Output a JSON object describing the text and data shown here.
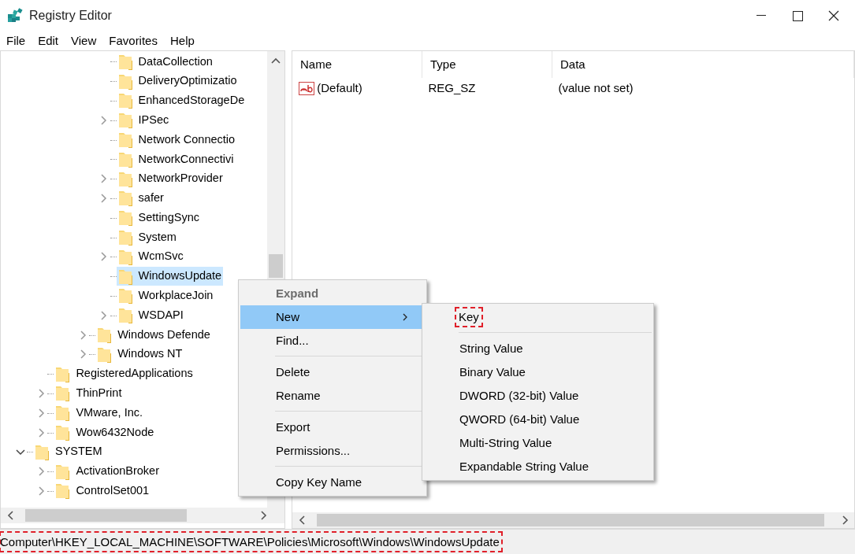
{
  "window": {
    "title": "Registry Editor"
  },
  "menu_bar": [
    "File",
    "Edit",
    "View",
    "Favorites",
    "Help"
  ],
  "tree": [
    {
      "children": [
        {
          "children": [
            {
              "children": [
                {
                  "children": [
                    {
                      "label": "DataCollection",
                      "selected": false
                    },
                    {
                      "label": "DeliveryOptimizatio",
                      "selected": false
                    },
                    {
                      "label": "EnhancedStorageDe",
                      "selected": false
                    },
                    {
                      "label": "IPSec",
                      "expanded": false,
                      "selected": false
                    },
                    {
                      "label": "Network Connectio",
                      "selected": false
                    },
                    {
                      "label": "NetworkConnectivi",
                      "selected": false
                    },
                    {
                      "label": "NetworkProvider",
                      "expanded": false,
                      "selected": false
                    },
                    {
                      "label": "safer",
                      "expanded": false,
                      "selected": false
                    },
                    {
                      "label": "SettingSync",
                      "selected": false
                    },
                    {
                      "label": "System",
                      "selected": false
                    },
                    {
                      "label": "WcmSvc",
                      "expanded": false,
                      "selected": false
                    },
                    {
                      "label": "WindowsUpdate",
                      "selected": true
                    },
                    {
                      "label": "WorkplaceJoin",
                      "selected": false
                    },
                    {
                      "label": "WSDAPI",
                      "expanded": false,
                      "selected": false
                    }
                  ]
                },
                {
                  "label": "Windows Defende",
                  "expanded": false,
                  "selected": false
                },
                {
                  "label": "Windows NT",
                  "expanded": false,
                  "selected": false
                }
              ]
            }
          ]
        },
        {
          "label": "RegisteredApplications",
          "selected": false
        },
        {
          "label": "ThinPrint",
          "expanded": false,
          "selected": false
        },
        {
          "label": "VMware, Inc.",
          "expanded": false,
          "selected": false
        },
        {
          "label": "Wow6432Node",
          "expanded": false,
          "selected": false
        }
      ]
    },
    {
      "label": "SYSTEM",
      "expanded": true,
      "selected": false,
      "children": [
        {
          "label": "ActivationBroker",
          "expanded": false,
          "selected": false
        },
        {
          "label": "ControlSet001",
          "expanded": false,
          "selected": false
        }
      ]
    }
  ],
  "values_table": {
    "columns": [
      "Name",
      "Type",
      "Data"
    ],
    "rows": [
      {
        "name": "(Default)",
        "type": "REG_SZ",
        "data": "(value not set)"
      }
    ]
  },
  "context_menu": [
    {
      "kind": "item",
      "label": "Expand",
      "bold": true,
      "disabled": true,
      "selected": false
    },
    {
      "kind": "item",
      "label": "New",
      "submenu": true,
      "selected": true
    },
    {
      "kind": "item",
      "label": "Find...",
      "selected": false
    },
    {
      "kind": "separator"
    },
    {
      "kind": "item",
      "label": "Delete",
      "selected": false
    },
    {
      "kind": "item",
      "label": "Rename",
      "selected": false
    },
    {
      "kind": "separator"
    },
    {
      "kind": "item",
      "label": "Export",
      "selected": false
    },
    {
      "kind": "item",
      "label": "Permissions...",
      "selected": false
    },
    {
      "kind": "separator"
    },
    {
      "kind": "item",
      "label": "Copy Key Name",
      "selected": false
    }
  ],
  "submenu": [
    {
      "kind": "item",
      "label": "Key",
      "highlighted": true
    },
    {
      "kind": "separator"
    },
    {
      "kind": "item",
      "label": "String Value"
    },
    {
      "kind": "item",
      "label": "Binary Value"
    },
    {
      "kind": "item",
      "label": "DWORD (32-bit) Value"
    },
    {
      "kind": "item",
      "label": "QWORD (64-bit) Value"
    },
    {
      "kind": "item",
      "label": "Multi-String Value"
    },
    {
      "kind": "item",
      "label": "Expandable String Value"
    }
  ],
  "status_bar": {
    "path": "Computer\\HKEY_LOCAL_MACHINE\\SOFTWARE\\Policies\\Microsoft\\Windows\\WindowsUpdate",
    "highlighted": true
  }
}
